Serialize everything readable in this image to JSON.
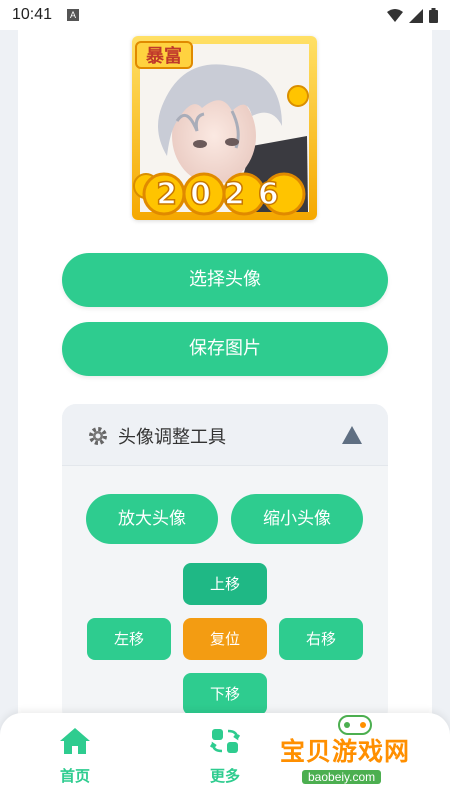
{
  "status_bar": {
    "time": "10:41",
    "notification_glyph": "A",
    "icons": [
      "wifi-icon",
      "signal-icon",
      "battery-icon"
    ]
  },
  "avatar": {
    "badge_text": "暴富",
    "year_text": "2026"
  },
  "actions": {
    "select_avatar": "选择头像",
    "save_image": "保存图片"
  },
  "tool_panel": {
    "title": "头像调整工具",
    "zoom_in": "放大头像",
    "zoom_out": "缩小头像",
    "move_up": "上移",
    "move_left": "左移",
    "reset": "复位",
    "move_right": "右移",
    "move_down": "下移"
  },
  "bottom_nav": {
    "home": "首页",
    "more": "更多"
  },
  "watermark": {
    "text": "宝贝游戏网",
    "url": "baobeiy.com"
  },
  "colors": {
    "accent_green": "#2ecc8f",
    "dark_green": "#1fb885",
    "orange": "#f39c12",
    "panel_bg": "#f3f5f7",
    "page_bg": "#eef1f5"
  }
}
